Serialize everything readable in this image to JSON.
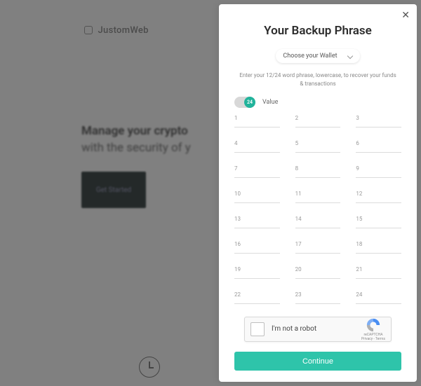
{
  "bg": {
    "logo_text": "JustomWeb",
    "hero_line1": "Manage your crypto",
    "hero_line2": "with the security of y",
    "cta_label": "Get Started"
  },
  "modal": {
    "title": "Your Backup Phrase",
    "wallet_select_label": "Choose your Wallet",
    "instruction": "Enter your 12/24 word phrase, lowercase, to recover your funds & transactions",
    "toggle_value": "24",
    "toggle_label": "Value",
    "word_indices": [
      "1",
      "2",
      "3",
      "4",
      "5",
      "6",
      "7",
      "8",
      "9",
      "10",
      "11",
      "12",
      "13",
      "14",
      "15",
      "16",
      "17",
      "18",
      "19",
      "20",
      "21",
      "22",
      "23",
      "24"
    ],
    "recaptcha": {
      "label": "I'm not a robot",
      "brand": "reCAPTCHA",
      "terms": "Privacy - Terms"
    },
    "continue_label": "Continue"
  },
  "colors": {
    "accent": "#2ec4aa"
  }
}
